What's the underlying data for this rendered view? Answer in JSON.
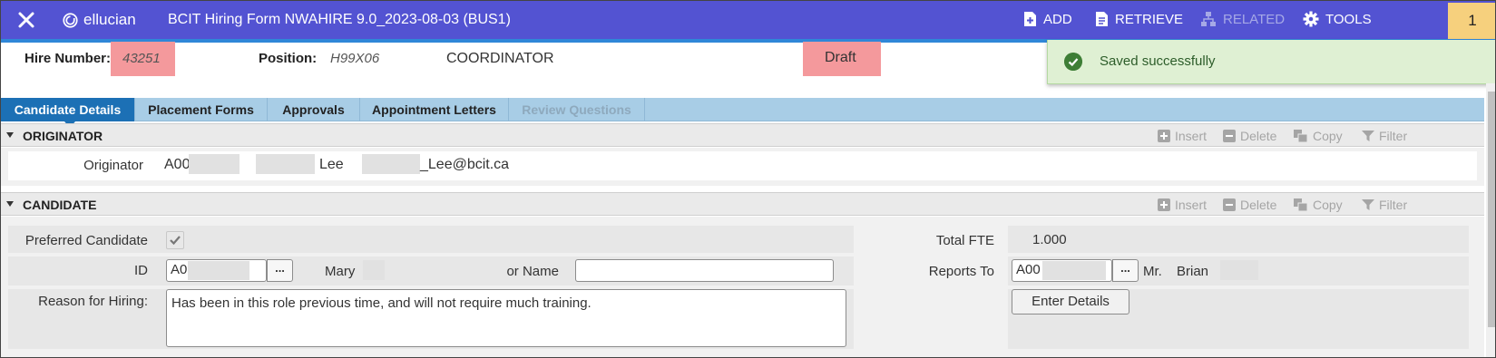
{
  "topbar": {
    "brand": "ellucian",
    "title": "BCIT Hiring Form NWAHIRE 9.0_2023-08-03 (BUS1)",
    "add": "ADD",
    "retrieve": "RETRIEVE",
    "related": "RELATED",
    "tools": "TOOLS",
    "notification_count": "1"
  },
  "header": {
    "hire_number_label": "Hire Number:",
    "hire_number": "43251",
    "position_label": "Position:",
    "position_code": "H99X06",
    "position_title": "COORDINATOR",
    "status": "Draft"
  },
  "toast": {
    "message": "Saved successfully"
  },
  "tabs": [
    {
      "label": "Candidate Details"
    },
    {
      "label": "Placement Forms"
    },
    {
      "label": "Approvals"
    },
    {
      "label": "Appointment Letters"
    },
    {
      "label": "Review Questions"
    }
  ],
  "toolbar": {
    "insert": "Insert",
    "delete": "Delete",
    "copy": "Copy",
    "filter": "Filter"
  },
  "originator": {
    "section_title": "ORIGINATOR",
    "label": "Originator",
    "id": "A00",
    "last_name": "Lee",
    "email": "_Lee@bcit.ca"
  },
  "candidate": {
    "section_title": "CANDIDATE",
    "preferred_label": "Preferred Candidate",
    "id_label": "ID",
    "id_value": "A0",
    "lookup": "...",
    "first_name": "Mary",
    "or_name_label": "or Name",
    "reason_label": "Reason for Hiring:",
    "reason_text": "Has been in this role previous time, and will not require much training.",
    "total_fte_label": "Total FTE",
    "total_fte": "1.000",
    "reports_to_label": "Reports To",
    "reports_to_id": "A00",
    "reports_to_title": "Mr.",
    "reports_to_name": "Brian",
    "enter_details": "Enter Details"
  },
  "colors": {
    "topbar": "#5353d2",
    "accent_strip": "#2f87d8",
    "active_tab": "#1c70b5",
    "tab_bar": "#a8cde6",
    "highlight": "#f4999c",
    "toast_bg": "#dff0d3",
    "notification": "#f6d07d"
  },
  "icons": [
    "close-icon",
    "ellucian-logo-icon",
    "add-icon",
    "retrieve-icon",
    "related-icon",
    "gear-icon",
    "checkmark-circle-icon",
    "insert-icon",
    "delete-icon",
    "copy-icon",
    "filter-icon",
    "collapse-triangle-icon",
    "checkbox-check-icon"
  ]
}
